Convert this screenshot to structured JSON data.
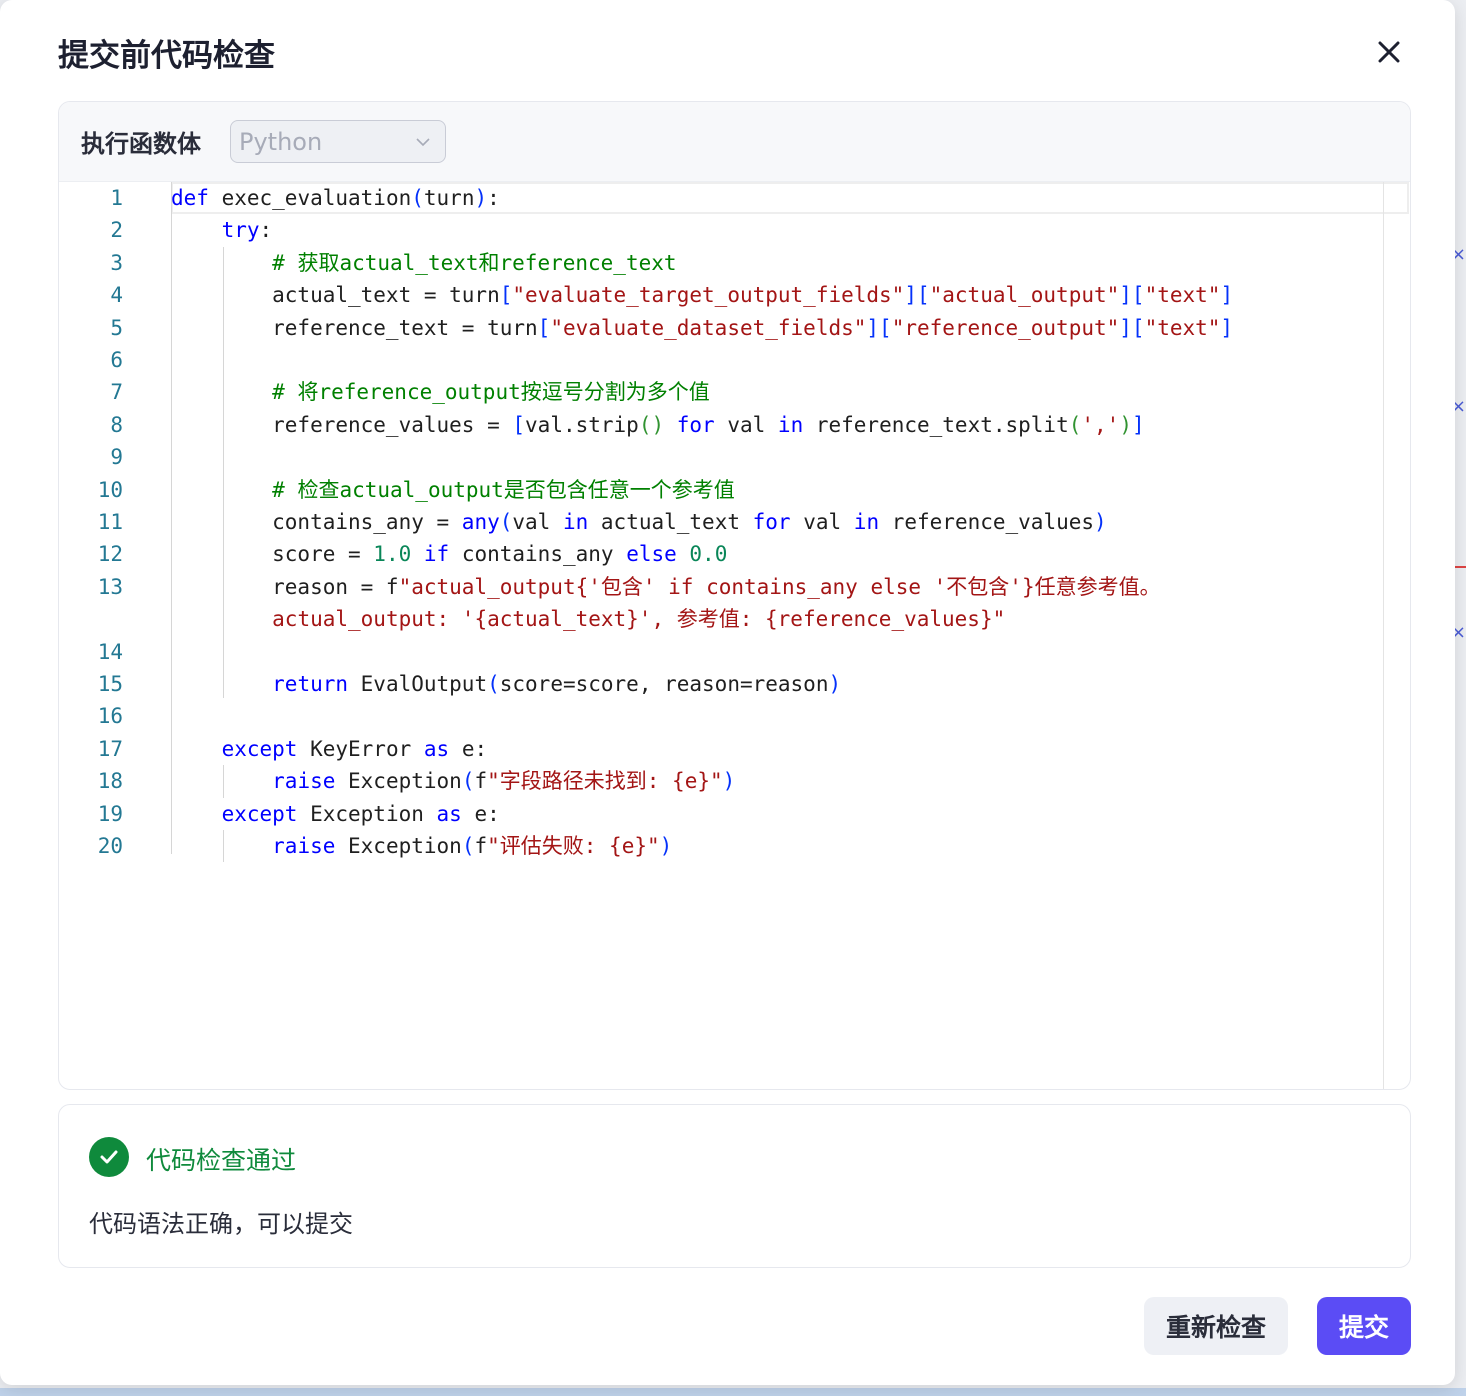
{
  "dialog": {
    "title": "提交前代码检查",
    "close_icon": "close-icon"
  },
  "editor": {
    "label": "执行函数体",
    "language": "Python",
    "language_icon": "chevron-down-icon",
    "line_numbers": [
      "1",
      "2",
      "3",
      "4",
      "5",
      "6",
      "7",
      "8",
      "9",
      "10",
      "11",
      "12",
      "13",
      "",
      "14",
      "15",
      "16",
      "17",
      "18",
      "19",
      "20"
    ],
    "lines": [
      {
        "segs": [
          [
            "kw",
            "def"
          ],
          [
            "",
            " exec_evaluation"
          ],
          [
            "br1",
            "("
          ],
          [
            "",
            "turn"
          ],
          [
            "br1",
            ")"
          ],
          [
            "",
            ":"
          ]
        ]
      },
      {
        "segs": [
          [
            "",
            "    "
          ],
          [
            "kw",
            "try"
          ],
          [
            "",
            ":"
          ]
        ]
      },
      {
        "segs": [
          [
            "",
            "        "
          ],
          [
            "com",
            "# 获取actual_text和reference_text"
          ]
        ]
      },
      {
        "segs": [
          [
            "",
            "        actual_text = turn"
          ],
          [
            "br1",
            "["
          ],
          [
            "str",
            "\"evaluate_target_output_fields\""
          ],
          [
            "br1",
            "]["
          ],
          [
            "str",
            "\"actual_output\""
          ],
          [
            "br1",
            "]["
          ],
          [
            "str",
            "\"text\""
          ],
          [
            "br1",
            "]"
          ]
        ]
      },
      {
        "segs": [
          [
            "",
            "        reference_text = turn"
          ],
          [
            "br1",
            "["
          ],
          [
            "str",
            "\"evaluate_dataset_fields\""
          ],
          [
            "br1",
            "]["
          ],
          [
            "str",
            "\"reference_output\""
          ],
          [
            "br1",
            "]["
          ],
          [
            "str",
            "\"text\""
          ],
          [
            "br1",
            "]"
          ]
        ]
      },
      {
        "segs": [
          [
            "",
            ""
          ]
        ]
      },
      {
        "segs": [
          [
            "",
            "        "
          ],
          [
            "com",
            "# 将reference_output按逗号分割为多个值"
          ]
        ]
      },
      {
        "segs": [
          [
            "",
            "        reference_values = "
          ],
          [
            "br1",
            "["
          ],
          [
            "",
            "val.strip"
          ],
          [
            "br2",
            "()"
          ],
          [
            "",
            ""
          ],
          [
            "kw",
            " for"
          ],
          [
            "",
            " val "
          ],
          [
            "kw",
            "in"
          ],
          [
            "",
            " reference_text.split"
          ],
          [
            "br2",
            "("
          ],
          [
            "str",
            "','"
          ],
          [
            "br2",
            ")"
          ],
          [
            "br1",
            "]"
          ]
        ]
      },
      {
        "segs": [
          [
            "",
            ""
          ]
        ]
      },
      {
        "segs": [
          [
            "",
            "        "
          ],
          [
            "com",
            "# 检查actual_output是否包含任意一个参考值"
          ]
        ]
      },
      {
        "segs": [
          [
            "",
            "        contains_any = "
          ],
          [
            "kw",
            "any"
          ],
          [
            "br1",
            "("
          ],
          [
            "",
            "val "
          ],
          [
            "kw",
            "in"
          ],
          [
            "",
            " actual_text "
          ],
          [
            "kw",
            "for"
          ],
          [
            "",
            " val "
          ],
          [
            "kw",
            "in"
          ],
          [
            "",
            " reference_values"
          ],
          [
            "br1",
            ")"
          ]
        ]
      },
      {
        "segs": [
          [
            "",
            "        score = "
          ],
          [
            "num",
            "1.0"
          ],
          [
            "kw",
            " if"
          ],
          [
            "",
            " contains_any "
          ],
          [
            "kw",
            "else"
          ],
          [
            "num",
            " 0.0"
          ]
        ]
      },
      {
        "segs": [
          [
            "",
            "        reason = f"
          ],
          [
            "str",
            "\"actual_output{'包含' if contains_any else '不包含'}任意参考值。"
          ]
        ]
      },
      {
        "segs": [
          [
            "",
            "        "
          ],
          [
            "str",
            "actual_output: '{actual_text}', 参考值: {reference_values}\""
          ]
        ]
      },
      {
        "segs": [
          [
            "",
            ""
          ]
        ]
      },
      {
        "segs": [
          [
            "",
            "        "
          ],
          [
            "kw",
            "return"
          ],
          [
            "",
            " EvalOutput"
          ],
          [
            "br1",
            "("
          ],
          [
            "",
            "score=score, reason=reason"
          ],
          [
            "br1",
            ")"
          ]
        ]
      },
      {
        "segs": [
          [
            "",
            ""
          ]
        ]
      },
      {
        "segs": [
          [
            "",
            "    "
          ],
          [
            "kw",
            "except"
          ],
          [
            "",
            " KeyError "
          ],
          [
            "kw",
            "as"
          ],
          [
            "",
            " e:"
          ]
        ]
      },
      {
        "segs": [
          [
            "",
            "        "
          ],
          [
            "kw",
            "raise"
          ],
          [
            "",
            " Exception"
          ],
          [
            "br1",
            "("
          ],
          [
            "",
            "f"
          ],
          [
            "str",
            "\"字段路径未找到: {e}\""
          ],
          [
            "br1",
            ")"
          ]
        ]
      },
      {
        "segs": [
          [
            "",
            "    "
          ],
          [
            "kw",
            "except"
          ],
          [
            "",
            " Exception "
          ],
          [
            "kw",
            "as"
          ],
          [
            "",
            " e:"
          ]
        ]
      },
      {
        "segs": [
          [
            "",
            "        "
          ],
          [
            "kw",
            "raise"
          ],
          [
            "",
            " Exception"
          ],
          [
            "br1",
            "("
          ],
          [
            "",
            "f"
          ],
          [
            "str",
            "\"评估失败: {e}\""
          ],
          [
            "br1",
            ")"
          ]
        ]
      }
    ]
  },
  "result": {
    "status_icon": "check-circle-icon",
    "title": "代码检查通过",
    "description": "代码语法正确，可以提交"
  },
  "footer": {
    "recheck_label": "重新检查",
    "submit_label": "提交"
  },
  "colors": {
    "accent": "#5b4cf5",
    "success": "#0f8a3c"
  }
}
